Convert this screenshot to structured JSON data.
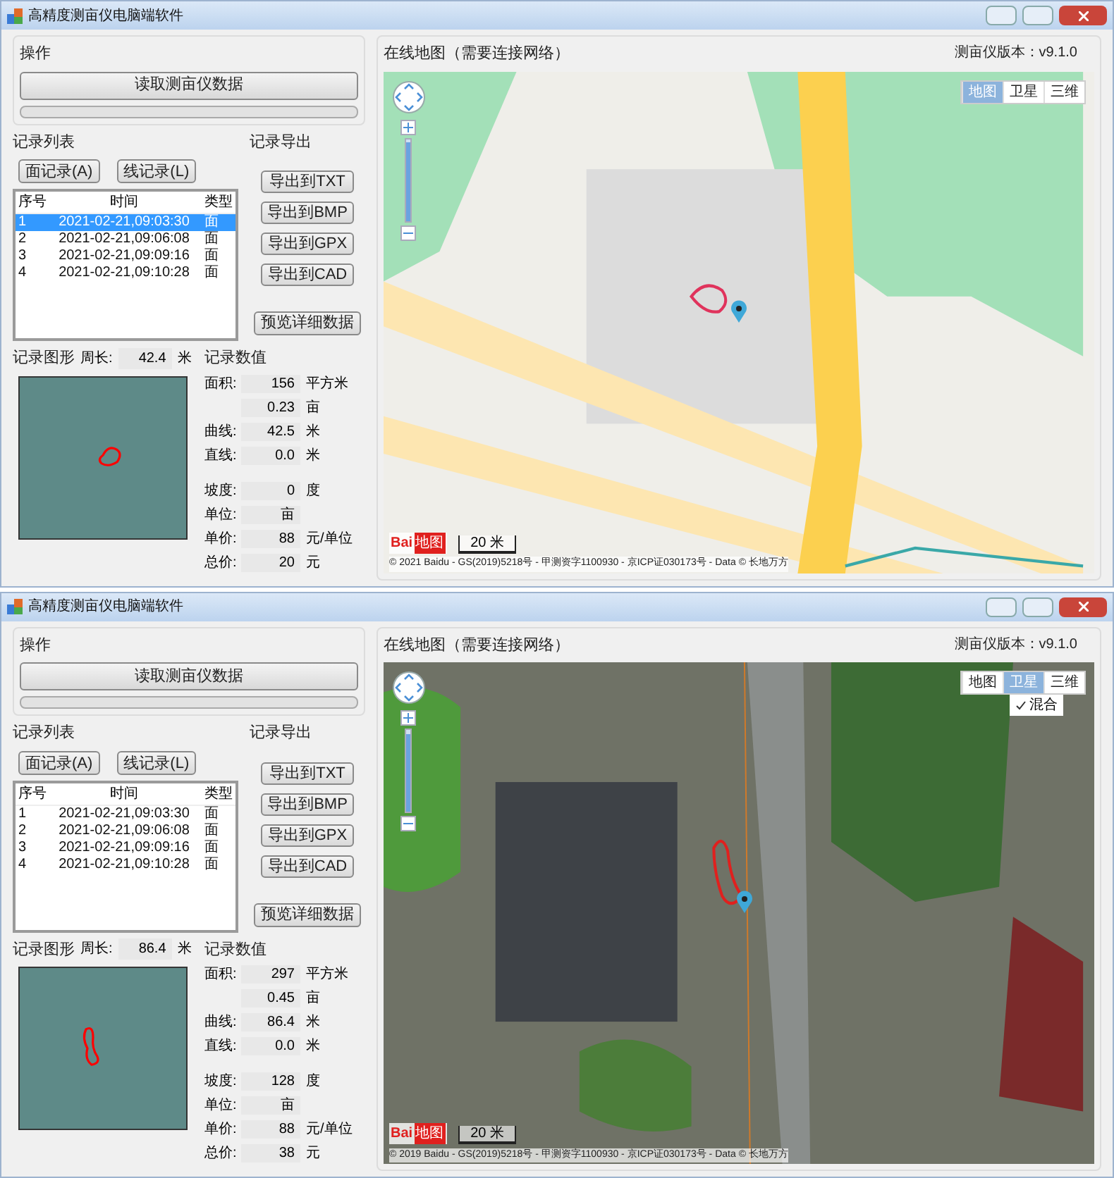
{
  "windows": [
    {
      "title": "高精度测亩仪电脑端软件",
      "operation": {
        "title": "操作",
        "read_button": "读取测亩仪数据",
        "progress": {
          "level": 0
        }
      },
      "records": {
        "title": "记录列表",
        "buttons": [
          "面记录(A)",
          "线记录(L)"
        ],
        "columns": [
          "序号",
          "时间",
          "类型"
        ],
        "rows": [
          {
            "cells": [
              "1",
              "2021-02-21,09:03:30",
              "面"
            ],
            "selected": true
          },
          {
            "cells": [
              "2",
              "2021-02-21,09:06:08",
              "面"
            ],
            "selected": false
          },
          {
            "cells": [
              "3",
              "2021-02-21,09:09:16",
              "面"
            ],
            "selected": false
          },
          {
            "cells": [
              "4",
              "2021-02-21,09:10:28",
              "面"
            ],
            "selected": false
          }
        ]
      },
      "export": {
        "title": "记录导出",
        "buttons": [
          "导出到TXT",
          "导出到BMP",
          "导出到GPX",
          "导出到CAD"
        ],
        "preview_button": "预览详细数据"
      },
      "graphic": {
        "title": "记录图形",
        "perimeter_label": "周长:",
        "perimeter_value": "42.4",
        "perimeter_unit": "米",
        "kind": "blob"
      },
      "values": {
        "title": "记录数值",
        "measures": [
          {
            "label": "面积:",
            "value": "156",
            "unit": "平方米"
          },
          {
            "value": "0.23",
            "unit": "亩"
          },
          {
            "label": "曲线:",
            "value": "42.5",
            "unit": "米"
          },
          {
            "label": "直线:",
            "value": "0.0",
            "unit": "米"
          }
        ],
        "pricing": [
          {
            "label": "坡度:",
            "value": "0",
            "unit": "度"
          },
          {
            "label": "单位:",
            "value": "亩"
          },
          {
            "label": "单价:",
            "value": "88",
            "unit": "元/单位"
          },
          {
            "label": "总价:",
            "value": "20",
            "unit": "元"
          }
        ]
      },
      "map": {
        "title": "在线地图（需要连接网络）",
        "version": "测亩仪版本：v9.1.0",
        "kind": "street",
        "zoom": {
          "level": 0.95
        },
        "types": [
          {
            "label": "地图",
            "selected": true
          },
          {
            "label": "卫星",
            "selected": false
          },
          {
            "label": "三维",
            "selected": false
          }
        ],
        "logo": [
          "Bai",
          "地图"
        ],
        "scale": "20 米",
        "copyright": "© 2021 Baidu - GS(2019)5218号 - 甲测资字1100930 - 京ICP证030173号 - Data © 长地万方"
      }
    },
    {
      "title": "高精度测亩仪电脑端软件",
      "operation": {
        "title": "操作",
        "read_button": "读取测亩仪数据",
        "progress": {
          "level": 0
        }
      },
      "records": {
        "title": "记录列表",
        "buttons": [
          "面记录(A)",
          "线记录(L)"
        ],
        "columns": [
          "序号",
          "时间",
          "类型"
        ],
        "rows": [
          {
            "cells": [
              "1",
              "2021-02-21,09:03:30",
              "面"
            ],
            "selected": false
          },
          {
            "cells": [
              "2",
              "2021-02-21,09:06:08",
              "面"
            ],
            "selected": false
          },
          {
            "cells": [
              "3",
              "2021-02-21,09:09:16",
              "面"
            ],
            "selected": false
          },
          {
            "cells": [
              "4",
              "2021-02-21,09:10:28",
              "面"
            ],
            "selected": false
          }
        ]
      },
      "export": {
        "title": "记录导出",
        "buttons": [
          "导出到TXT",
          "导出到BMP",
          "导出到GPX",
          "导出到CAD"
        ],
        "preview_button": "预览详细数据"
      },
      "graphic": {
        "title": "记录图形",
        "perimeter_label": "周长:",
        "perimeter_value": "86.4",
        "perimeter_unit": "米",
        "kind": "strip"
      },
      "values": {
        "title": "记录数值",
        "measures": [
          {
            "label": "面积:",
            "value": "297",
            "unit": "平方米"
          },
          {
            "value": "0.45",
            "unit": "亩"
          },
          {
            "label": "曲线:",
            "value": "86.4",
            "unit": "米"
          },
          {
            "label": "直线:",
            "value": "0.0",
            "unit": "米"
          }
        ],
        "pricing": [
          {
            "label": "坡度:",
            "value": "128",
            "unit": "度"
          },
          {
            "label": "单位:",
            "value": "亩"
          },
          {
            "label": "单价:",
            "value": "88",
            "unit": "元/单位"
          },
          {
            "label": "总价:",
            "value": "38",
            "unit": "元"
          }
        ]
      },
      "map": {
        "title": "在线地图（需要连接网络）",
        "version": "测亩仪版本：v9.1.0",
        "kind": "satellite",
        "zoom": {
          "level": 0.95
        },
        "types": [
          {
            "label": "地图",
            "selected": false
          },
          {
            "label": "卫星",
            "selected": true
          },
          {
            "label": "三维",
            "selected": false
          }
        ],
        "hybrid": {
          "label": "混合",
          "checked": true
        },
        "logo": [
          "Bai",
          "地图"
        ],
        "scale": "20 米",
        "copyright": "© 2019 Baidu - GS(2019)5218号 - 甲测资字1100930 - 京ICP证030173号 - Data © 长地万方"
      }
    }
  ]
}
